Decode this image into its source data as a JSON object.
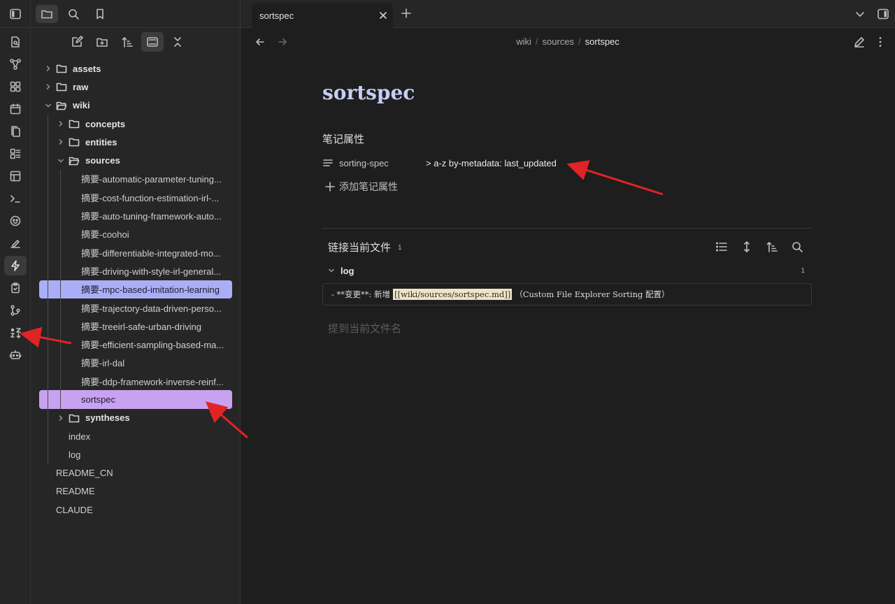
{
  "ribbon": {
    "icons": [
      "sidebar-toggle-icon",
      "quick-switcher-icon",
      "graph-view-icon",
      "canvas-icon",
      "daily-notes-icon",
      "templates-icon",
      "slides-icon",
      "table-view-icon",
      "command-palette-icon",
      "theme-icon",
      "draw-icon",
      "zap-icon",
      "clipboard-icon",
      "git-icon",
      "sort-icon",
      "bot-icon"
    ]
  },
  "file_panel": {
    "top_icons": [
      "files-tab-icon",
      "search-tab-icon",
      "bookmarks-tab-icon"
    ],
    "toolbar_icons": [
      "new-note-icon",
      "new-folder-icon",
      "sort-order-icon",
      "auto-reveal-icon",
      "collapse-all-icon"
    ],
    "tree": [
      {
        "label": "assets",
        "type": "folder",
        "depth": 0,
        "expanded": false
      },
      {
        "label": "raw",
        "type": "folder",
        "depth": 0,
        "expanded": false
      },
      {
        "label": "wiki",
        "type": "folder",
        "depth": 0,
        "expanded": true
      },
      {
        "label": "concepts",
        "type": "folder",
        "depth": 1,
        "expanded": false
      },
      {
        "label": "entities",
        "type": "folder",
        "depth": 1,
        "expanded": false
      },
      {
        "label": "sources",
        "type": "folder",
        "depth": 1,
        "expanded": true
      },
      {
        "label": "摘要-automatic-parameter-tuning...",
        "type": "file",
        "depth": 2
      },
      {
        "label": "摘要-cost-function-estimation-irl-...",
        "type": "file",
        "depth": 2
      },
      {
        "label": "摘要-auto-tuning-framework-auto...",
        "type": "file",
        "depth": 2
      },
      {
        "label": "摘要-coohoi",
        "type": "file",
        "depth": 2
      },
      {
        "label": "摘要-differentiable-integrated-mo...",
        "type": "file",
        "depth": 2
      },
      {
        "label": "摘要-driving-with-style-irl-general...",
        "type": "file",
        "depth": 2
      },
      {
        "label": "摘要-mpc-based-imitation-learning",
        "type": "file",
        "depth": 2,
        "state": "hover"
      },
      {
        "label": "摘要-trajectory-data-driven-perso...",
        "type": "file",
        "depth": 2
      },
      {
        "label": "摘要-treeirl-safe-urban-driving",
        "type": "file",
        "depth": 2
      },
      {
        "label": "摘要-efficient-sampling-based-ma...",
        "type": "file",
        "depth": 2
      },
      {
        "label": "摘要-irl-dal",
        "type": "file",
        "depth": 2
      },
      {
        "label": "摘要-ddp-framework-inverse-reinf...",
        "type": "file",
        "depth": 2
      },
      {
        "label": "sortspec",
        "type": "file",
        "depth": 2,
        "state": "selected"
      },
      {
        "label": "syntheses",
        "type": "folder",
        "depth": 1,
        "expanded": false
      },
      {
        "label": "index",
        "type": "file",
        "depth": 1
      },
      {
        "label": "log",
        "type": "file",
        "depth": 1
      },
      {
        "label": "README_CN",
        "type": "file",
        "depth": 0
      },
      {
        "label": "README",
        "type": "file",
        "depth": 0
      },
      {
        "label": "CLAUDE",
        "type": "file",
        "depth": 0
      }
    ]
  },
  "tab": {
    "title": "sortspec"
  },
  "breadcrumb": {
    "part1": "wiki",
    "sep": "/",
    "part2": "sources",
    "current": "sortspec"
  },
  "note": {
    "title": "sortspec",
    "properties_heading": "笔记属性",
    "property_key": "sorting-spec",
    "property_value": "> a-z by-metadata: last_updated",
    "add_property": "添加笔记属性"
  },
  "backlinks": {
    "heading": "链接当前文件",
    "count": "1",
    "group_label": "log",
    "group_count": "1",
    "result_prefix": "- **变更**: 新增",
    "result_link": "[[wiki/sources/sortspec.md]]",
    "result_suffix": "（Custom File Explorer Sorting 配置）",
    "mentions_placeholder": "提到当前文件名"
  },
  "colors": {
    "accent_title": "#c8cdf6",
    "hover_row": "#a9aef7",
    "selected_row": "#c8a2f0",
    "annotation_arrow": "#e02424"
  }
}
